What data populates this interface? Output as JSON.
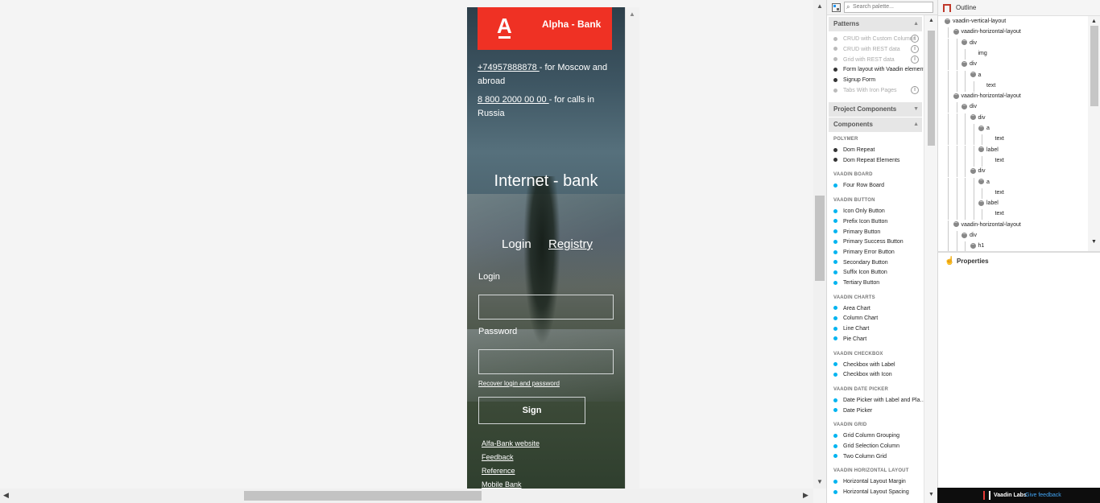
{
  "device": {
    "bank_name": "Alpha - Bank",
    "logo_letter": "А",
    "phone1_number": "+74957888878 ",
    "phone1_rest": "- for Moscow and abroad",
    "phone2_number": "8 800 2000 00 00 ",
    "phone2_rest": "- for calls in Russia",
    "title": "Internet - bank",
    "tab_login": "Login",
    "tab_registry": "Registry",
    "login_label": "Login",
    "password_label": "Password",
    "recover_link": "Recover login and password",
    "sign_button": "Sign",
    "footer_links": [
      "Alfa-Bank website",
      "Feedback",
      "Reference",
      "Mobile Bank"
    ]
  },
  "palette": {
    "search_placeholder": "Search palette...",
    "patterns_header": "Patterns",
    "patterns": [
      {
        "label": "CRUD with Custom Columns",
        "disabled": true
      },
      {
        "label": "CRUD with REST data",
        "disabled": true
      },
      {
        "label": "Grid with REST data",
        "disabled": true
      },
      {
        "label": "Form layout with Vaadin elements",
        "disabled": false
      },
      {
        "label": "Signup Form",
        "disabled": false
      },
      {
        "label": "Tabs With Iron Pages",
        "disabled": true
      }
    ],
    "project_components_header": "Project Components",
    "components_header": "Components",
    "categories": [
      {
        "name": "POLYMER",
        "items": [
          "Dom Repeat",
          "Dom Repeat Elements"
        ],
        "color": "#333333"
      },
      {
        "name": "VAADIN BOARD",
        "items": [
          "Four Row Board"
        ],
        "color": "#00b4f0"
      },
      {
        "name": "VAADIN BUTTON",
        "items": [
          "Icon Only Button",
          "Prefix Icon Button",
          "Primary Button",
          "Primary Success Button",
          "Primary Error Button",
          "Secondary Button",
          "Suffix Icon Button",
          "Tertiary Button"
        ],
        "color": "#00b4f0"
      },
      {
        "name": "VAADIN CHARTS",
        "items": [
          "Area Chart",
          "Column Chart",
          "Line Chart",
          "Pie Chart"
        ],
        "color": "#00b4f0"
      },
      {
        "name": "VAADIN CHECKBOX",
        "items": [
          "Checkbox with Label",
          "Checkbox with Icon"
        ],
        "color": "#00b4f0"
      },
      {
        "name": "VAADIN DATE PICKER",
        "items": [
          "Date Picker with Label and Pla…",
          "Date Picker"
        ],
        "color": "#00b4f0"
      },
      {
        "name": "VAADIN GRID",
        "items": [
          "Grid Column Grouping",
          "Grid Selection Column",
          "Two Column Grid"
        ],
        "color": "#00b4f0"
      },
      {
        "name": "VAADIN HORIZONTAL LAYOUT",
        "items": [
          "Horizontal Layout Margin",
          "Horizontal Layout Spacing"
        ],
        "color": "#00b4f0"
      }
    ]
  },
  "outline": {
    "title": "Outline",
    "nodes": [
      {
        "label": "vaadin-vertical-layout",
        "depth": 0,
        "toggle": true
      },
      {
        "label": "vaadin-horizontal-layout",
        "depth": 1,
        "toggle": true
      },
      {
        "label": "div",
        "depth": 2,
        "toggle": true
      },
      {
        "label": "img",
        "depth": 3,
        "toggle": false
      },
      {
        "label": "div",
        "depth": 2,
        "toggle": true
      },
      {
        "label": "a",
        "depth": 3,
        "toggle": true
      },
      {
        "label": "text",
        "depth": 4,
        "toggle": false
      },
      {
        "label": "vaadin-horizontal-layout",
        "depth": 1,
        "toggle": true
      },
      {
        "label": "div",
        "depth": 2,
        "toggle": true
      },
      {
        "label": "div",
        "depth": 3,
        "toggle": true
      },
      {
        "label": "a",
        "depth": 4,
        "toggle": true
      },
      {
        "label": "text",
        "depth": 5,
        "toggle": false
      },
      {
        "label": "label",
        "depth": 4,
        "toggle": true
      },
      {
        "label": "text",
        "depth": 5,
        "toggle": false
      },
      {
        "label": "div",
        "depth": 3,
        "toggle": true
      },
      {
        "label": "a",
        "depth": 4,
        "toggle": true
      },
      {
        "label": "text",
        "depth": 5,
        "toggle": false
      },
      {
        "label": "label",
        "depth": 4,
        "toggle": true
      },
      {
        "label": "text",
        "depth": 5,
        "toggle": false
      },
      {
        "label": "vaadin-horizontal-layout",
        "depth": 1,
        "toggle": true
      },
      {
        "label": "div",
        "depth": 2,
        "toggle": true
      },
      {
        "label": "h1",
        "depth": 3,
        "toggle": true
      }
    ]
  },
  "properties": {
    "title": "Properties"
  },
  "footer": {
    "brand": "Vaadin Labs",
    "feedback": "Give feedback"
  },
  "colors": {
    "brand_red": "#ef3124",
    "accent_blue": "#00b4f0",
    "feedback_blue": "#42a5f5"
  }
}
